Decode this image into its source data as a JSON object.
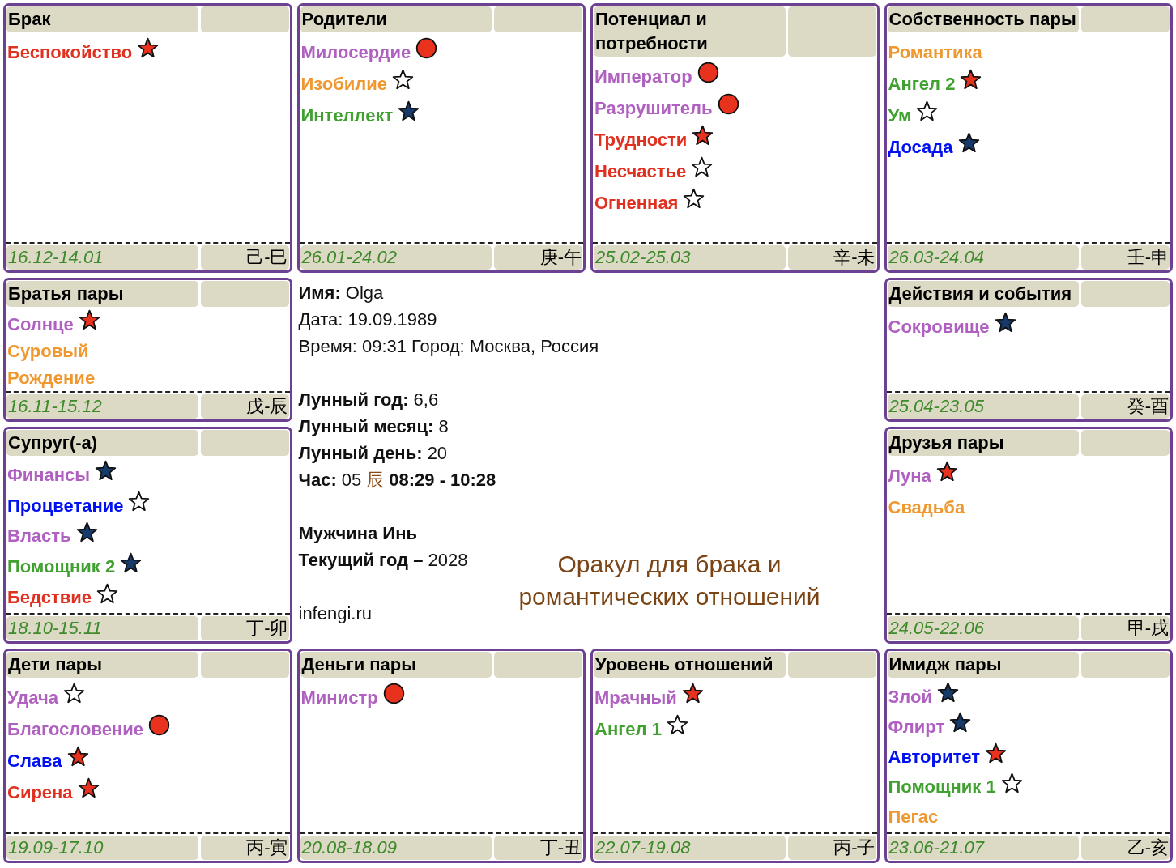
{
  "palaces": [
    {
      "title": "Брак",
      "items": [
        {
          "text": "Беспокойство",
          "color": "#e03020",
          "kind": "red-star"
        }
      ],
      "dates": "16.12-14.01",
      "branch": "己-巳"
    },
    {
      "title": "Родители",
      "items": [
        {
          "text": "Милосердие",
          "color": "#b060c0",
          "kind": "red-circle"
        },
        {
          "text": "Изобилие",
          "color": "#f09830",
          "kind": "empty-star"
        },
        {
          "text": "Интеллект",
          "color": "#40a030",
          "kind": "blue-star"
        }
      ],
      "dates": "26.01-24.02",
      "branch": "庚-午"
    },
    {
      "title": "Потенциал и потребности",
      "items": [
        {
          "text": "Император",
          "color": "#b060c0",
          "kind": "red-circle"
        },
        {
          "text": "Разрушитель",
          "color": "#b060c0",
          "kind": "red-circle"
        },
        {
          "text": "Трудности",
          "color": "#e03020",
          "kind": "red-star"
        },
        {
          "text": "Несчастье",
          "color": "#e03020",
          "kind": "empty-star"
        },
        {
          "text": "Огненная",
          "color": "#e03020",
          "kind": "empty-star"
        }
      ],
      "dates": "25.02-25.03",
      "branch": "辛-未"
    },
    {
      "title": "Собственность пары",
      "items": [
        {
          "text": "Романтика",
          "color": "#f09830",
          "kind": "plain"
        },
        {
          "text": "Ангел 2",
          "color": "#40a030",
          "kind": "red-star"
        },
        {
          "text": "Ум",
          "color": "#40a030",
          "kind": "empty-star"
        },
        {
          "text": "Досада",
          "color": "#0010f0",
          "kind": "blue-star"
        }
      ],
      "dates": "26.03-24.04",
      "branch": "壬-申"
    },
    {
      "title": "Братья пары",
      "items": [
        {
          "text": "Солнце",
          "color": "#b060c0",
          "kind": "red-star"
        },
        {
          "text": "Суровый",
          "color": "#f09830",
          "kind": "plain"
        },
        {
          "text": "Рождение",
          "color": "#f09830",
          "kind": "plain"
        }
      ],
      "dates": "16.11-15.12",
      "branch": "戊-辰"
    },
    {
      "title": "Действия и события",
      "items": [
        {
          "text": "Сокровище",
          "color": "#b060c0",
          "kind": "blue-star"
        }
      ],
      "dates": "25.04-23.05",
      "branch": "癸-酉"
    },
    {
      "title": "Супруг(-а)",
      "items": [
        {
          "text": "Финансы",
          "color": "#b060c0",
          "kind": "blue-star"
        },
        {
          "text": "Процветание",
          "color": "#0010f0",
          "kind": "empty-star"
        },
        {
          "text": "Власть",
          "color": "#b060c0",
          "kind": "blue-star"
        },
        {
          "text": "Помощник 2",
          "color": "#40a030",
          "kind": "blue-star"
        },
        {
          "text": "Бедствие",
          "color": "#e03020",
          "kind": "empty-star"
        }
      ],
      "dates": "18.10-15.11",
      "branch": "丁-卯"
    },
    {
      "title": "Друзья пары",
      "items": [
        {
          "text": "Луна",
          "color": "#b060c0",
          "kind": "red-star"
        },
        {
          "text": "Свадьба",
          "color": "#f09830",
          "kind": "plain"
        }
      ],
      "dates": "24.05-22.06",
      "branch": "甲-戌"
    },
    {
      "title": "Дети пары",
      "items": [
        {
          "text": "Удача",
          "color": "#b060c0",
          "kind": "empty-star"
        },
        {
          "text": "Благословение",
          "color": "#b060c0",
          "kind": "red-circle"
        },
        {
          "text": "Слава",
          "color": "#0010f0",
          "kind": "red-star"
        },
        {
          "text": "Сирена",
          "color": "#e03020",
          "kind": "red-star"
        }
      ],
      "dates": "19.09-17.10",
      "branch": "丙-寅"
    },
    {
      "title": "Деньги пары",
      "items": [
        {
          "text": "Министр",
          "color": "#b060c0",
          "kind": "red-circle"
        }
      ],
      "dates": "20.08-18.09",
      "branch": "丁-丑"
    },
    {
      "title": "Уровень отношений",
      "items": [
        {
          "text": "Мрачный",
          "color": "#b060c0",
          "kind": "red-star"
        },
        {
          "text": "Ангел 1",
          "color": "#40a030",
          "kind": "empty-star"
        }
      ],
      "dates": "22.07-19.08",
      "branch": "丙-子"
    },
    {
      "title": "Имидж пары",
      "items": [
        {
          "text": "Злой",
          "color": "#b060c0",
          "kind": "blue-star"
        },
        {
          "text": "Флирт",
          "color": "#b060c0",
          "kind": "blue-star"
        },
        {
          "text": "Авторитет",
          "color": "#0010f0",
          "kind": "red-star"
        },
        {
          "text": "Помощник 1",
          "color": "#40a030",
          "kind": "empty-star"
        },
        {
          "text": "Пегас",
          "color": "#f09830",
          "kind": "plain"
        }
      ],
      "dates": "23.06-21.07",
      "branch": "乙-亥"
    }
  ],
  "info": {
    "person": [
      "**Имя:** Olga",
      "Дата: 19.09.1989",
      "Время: 09:31 Город: Москва, Россия"
    ],
    "lunar": [
      "**Лунный год:** 6,6",
      "**Лунный месяц:** 8",
      "**Лунный день:** 20"
    ],
    "hour": {
      "label": "Час:",
      "number": "05",
      "branch": "辰",
      "range": "08:29 - 10:28"
    },
    "gender": "Мужчина Инь",
    "current_year": "**Текущий год –** 2028",
    "site": "infengi.ru",
    "title": "Оракул для брака и романтических отношений"
  }
}
